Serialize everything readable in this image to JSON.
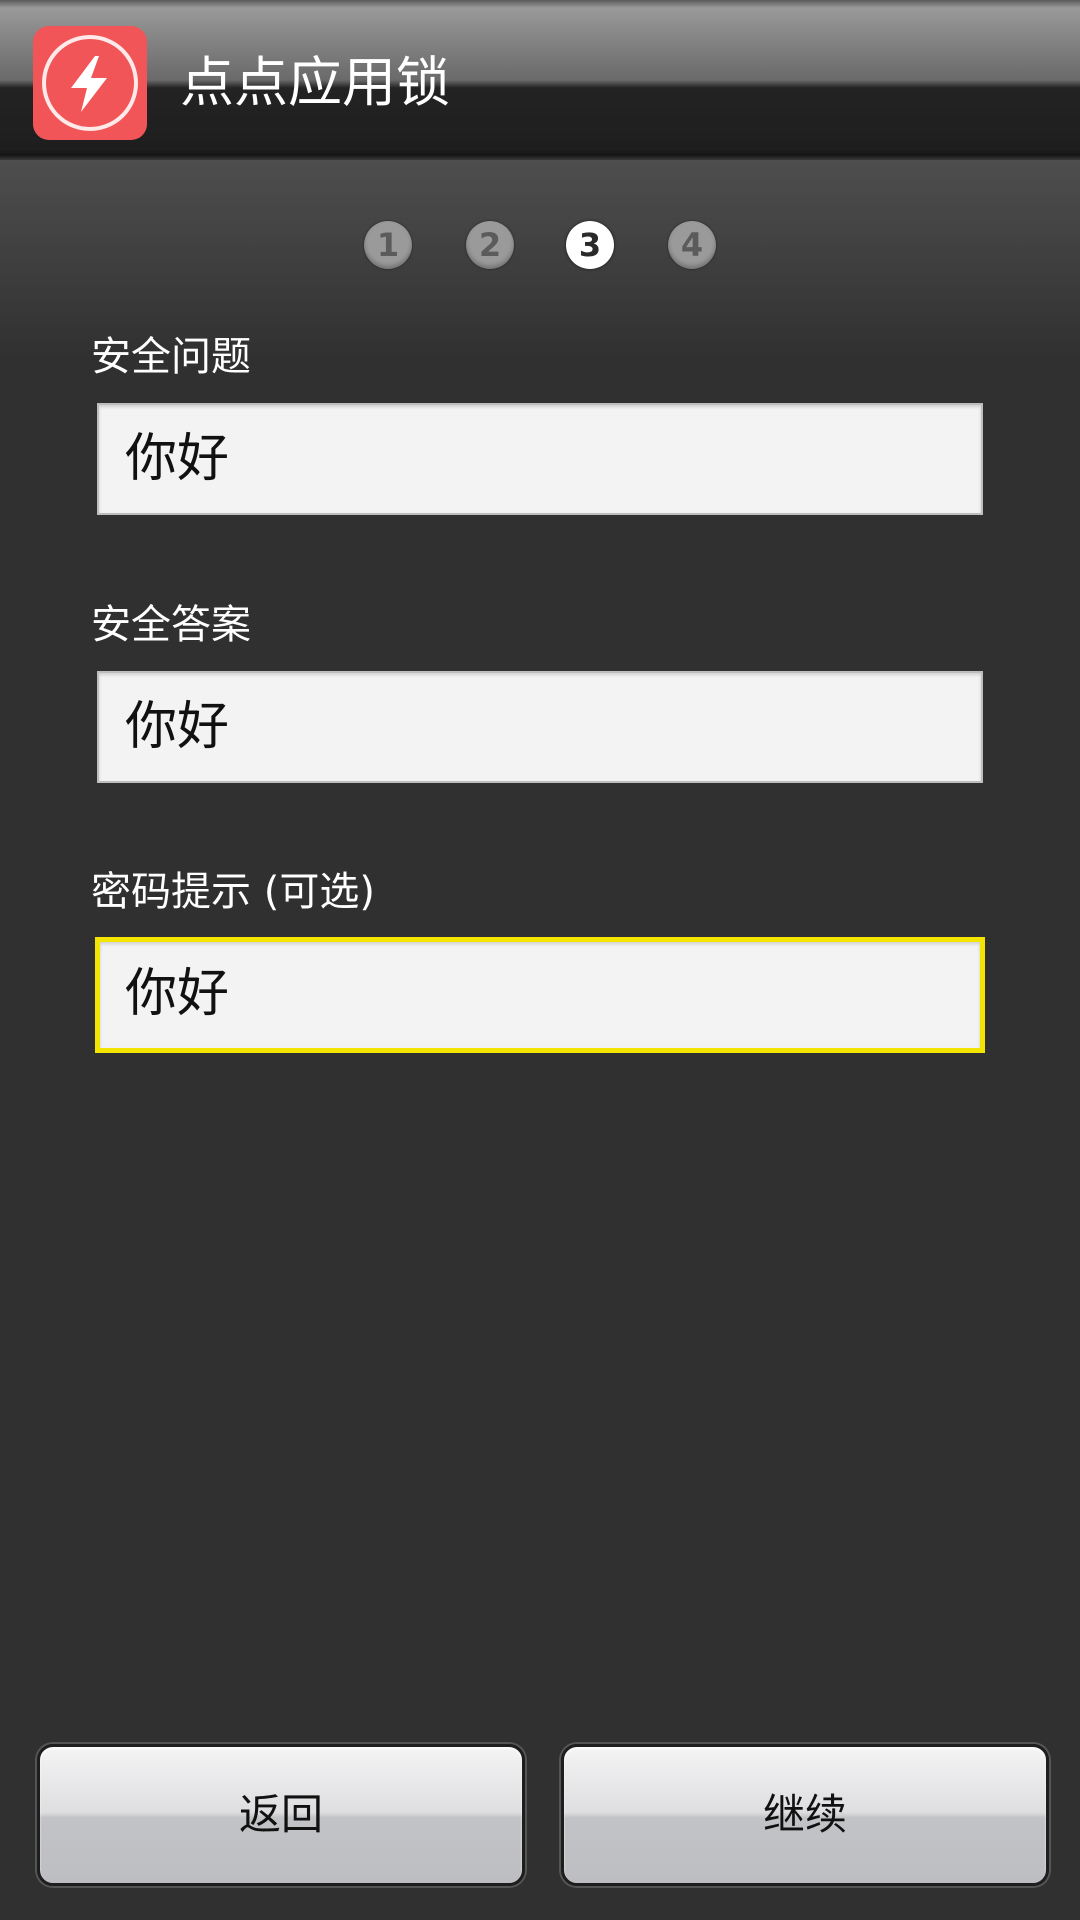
{
  "header": {
    "app_title": "点点应用锁",
    "icon": "lightning-bolt-icon",
    "icon_color": "#f25558"
  },
  "steps": [
    {
      "label": "1",
      "active": false
    },
    {
      "label": "2",
      "active": false
    },
    {
      "label": "3",
      "active": true
    },
    {
      "label": "4",
      "active": false
    }
  ],
  "form": {
    "security_question_label": "安全问题",
    "security_question_value": "你好",
    "security_answer_label": "安全答案",
    "security_answer_value": "你好",
    "password_hint_label": "密码提示 (可选)",
    "password_hint_value": "你好",
    "focus_color": "#f4e500"
  },
  "buttons": {
    "back_label": "返回",
    "continue_label": "继续"
  }
}
